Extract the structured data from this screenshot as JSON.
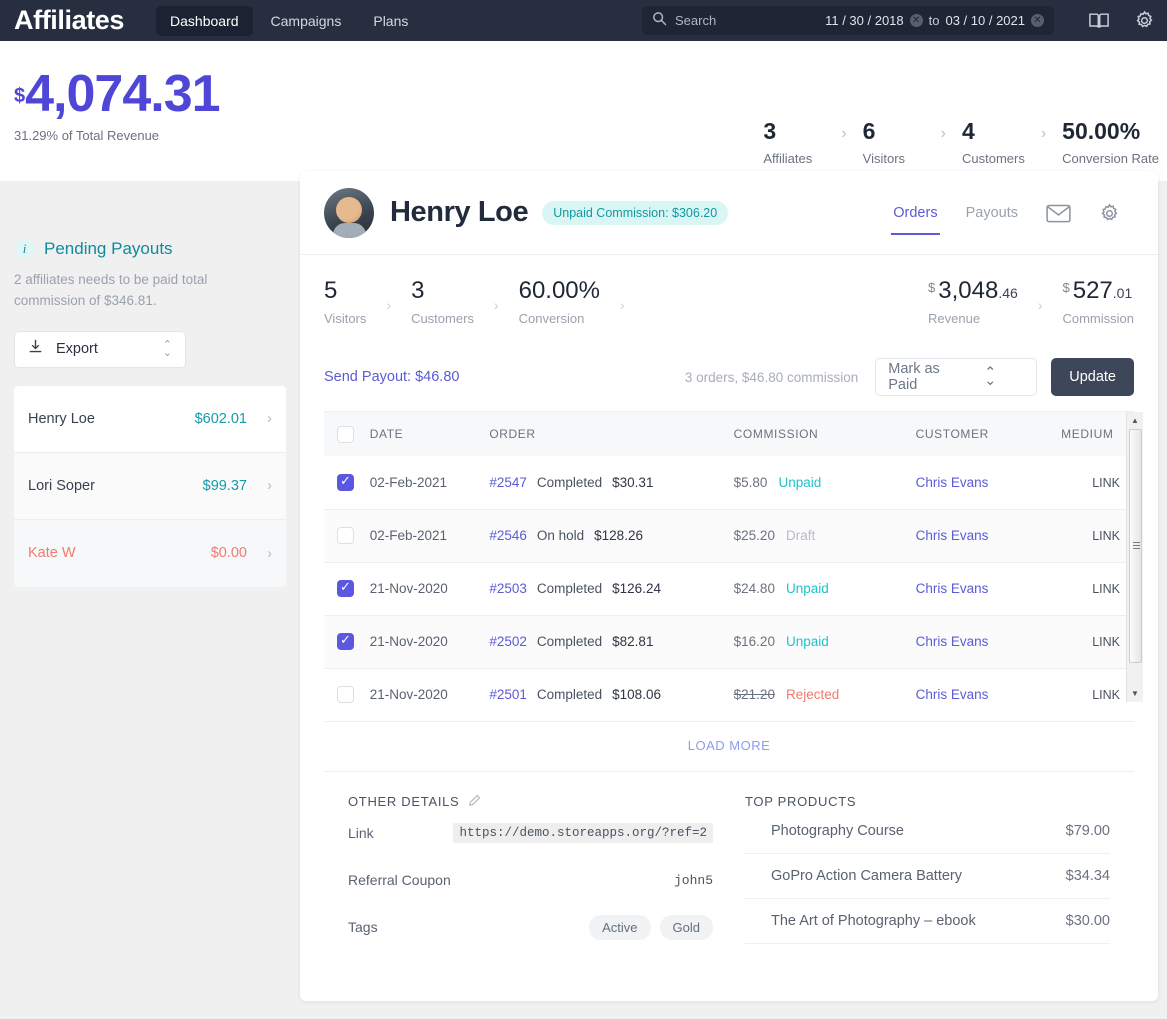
{
  "topbar": {
    "brand": "Affiliates",
    "nav": [
      {
        "label": "Dashboard",
        "active": true
      },
      {
        "label": "Campaigns",
        "active": false
      },
      {
        "label": "Plans",
        "active": false
      }
    ],
    "search": {
      "placeholder": "Search",
      "icon": "search-icon"
    },
    "date_from": "11 / 30 / 2018",
    "date_to_label": "to",
    "date_to": "03 / 10 / 2021",
    "icons": [
      "book-icon",
      "gear-icon"
    ]
  },
  "header": {
    "currency": "$",
    "revenue": "4,074.31",
    "subtitle": "31.29% of Total Revenue",
    "kpis": [
      {
        "value": "3",
        "label": "Affiliates"
      },
      {
        "value": "6",
        "label": "Visitors"
      },
      {
        "value": "4",
        "label": "Customers"
      },
      {
        "value": "50.00%",
        "label": "Conversion Rate"
      }
    ]
  },
  "sidebar": {
    "title": "Pending Payouts",
    "description": "2 affiliates needs to be paid total commission of $346.81.",
    "export_label": "Export",
    "payouts": [
      {
        "name": "Henry Loe",
        "amount": "$602.01",
        "muted": false
      },
      {
        "name": "Lori Soper",
        "amount": "$99.37",
        "muted": false
      },
      {
        "name": "Kate W",
        "amount": "$0.00",
        "muted": true
      }
    ]
  },
  "card": {
    "affiliate_name": "Henry Loe",
    "badge": "Unpaid Commission: $306.20",
    "tabs": [
      {
        "label": "Orders",
        "active": true
      },
      {
        "label": "Payouts",
        "active": false
      }
    ],
    "header_icons": [
      "mail-icon",
      "gear-icon"
    ],
    "stats": [
      {
        "value": "5",
        "label": "Visitors"
      },
      {
        "value": "3",
        "label": "Customers"
      },
      {
        "value": "60.00%",
        "label": "Conversion"
      }
    ],
    "money_stats": [
      {
        "currency": "$",
        "value": "3,048",
        "decimals": ".46",
        "label": "Revenue"
      },
      {
        "currency": "$",
        "value": "527",
        "decimals": ".01",
        "label": "Commission"
      }
    ],
    "payout_bar": {
      "send_payout": "Send Payout: $46.80",
      "note": "3 orders, $46.80 commission",
      "select_value": "Mark as Paid",
      "update_label": "Update"
    },
    "table": {
      "columns": [
        "DATE",
        "ORDER",
        "COMMISSION",
        "CUSTOMER",
        "MEDIUM"
      ],
      "rows": [
        {
          "checked": true,
          "date": "02-Feb-2021",
          "order_id": "#2547",
          "order_status": "Completed",
          "order_total": "$30.31",
          "commission": "$5.80",
          "comm_status": "Unpaid",
          "comm_status_kind": "unpaid",
          "customer": "Chris Evans",
          "medium": "LINK"
        },
        {
          "checked": false,
          "date": "02-Feb-2021",
          "order_id": "#2546",
          "order_status": "On hold",
          "order_total": "$128.26",
          "commission": "$25.20",
          "comm_status": "Draft",
          "comm_status_kind": "draft",
          "customer": "Chris Evans",
          "medium": "LINK"
        },
        {
          "checked": true,
          "date": "21-Nov-2020",
          "order_id": "#2503",
          "order_status": "Completed",
          "order_total": "$126.24",
          "commission": "$24.80",
          "comm_status": "Unpaid",
          "comm_status_kind": "unpaid",
          "customer": "Chris Evans",
          "medium": "LINK"
        },
        {
          "checked": true,
          "date": "21-Nov-2020",
          "order_id": "#2502",
          "order_status": "Completed",
          "order_total": "$82.81",
          "commission": "$16.20",
          "comm_status": "Unpaid",
          "comm_status_kind": "unpaid",
          "customer": "Chris Evans",
          "medium": "LINK"
        },
        {
          "checked": false,
          "date": "21-Nov-2020",
          "order_id": "#2501",
          "order_status": "Completed",
          "order_total": "$108.06",
          "commission": "$21.20",
          "comm_status": "Rejected",
          "comm_status_kind": "rejected",
          "customer": "Chris Evans",
          "medium": "LINK"
        }
      ],
      "load_more": "LOAD MORE"
    },
    "other_details": {
      "title": "OTHER DETAILS",
      "rows": [
        {
          "label": "Link",
          "value": "https://demo.storeapps.org/?ref=2",
          "kind": "code"
        },
        {
          "label": "Referral Coupon",
          "value": "john5",
          "kind": "text"
        },
        {
          "label": "Tags",
          "value": "",
          "kind": "tags",
          "tags": [
            "Active",
            "Gold"
          ]
        }
      ]
    },
    "top_products": {
      "title": "TOP PRODUCTS",
      "items": [
        {
          "name": "Photography Course",
          "price": "$79.00"
        },
        {
          "name": "GoPro Action Camera Battery",
          "price": "$34.34"
        },
        {
          "name": "The Art of Photography – ebook",
          "price": "$30.00"
        }
      ]
    }
  },
  "colors": {
    "topbar_bg": "#272e3f",
    "accent_indigo": "#5b5bd6",
    "accent_teal": "#159ba8",
    "danger": "#f2796f",
    "unpaid": "#1fc3c8"
  }
}
